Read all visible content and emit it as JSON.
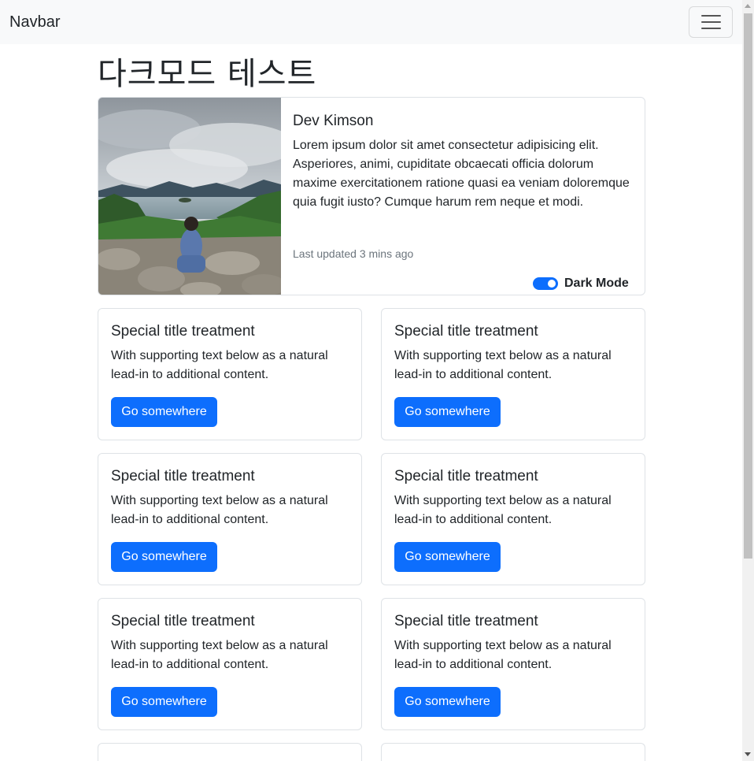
{
  "navbar": {
    "brand": "Navbar",
    "toggler_icon": "hamburger-icon"
  },
  "page": {
    "title": "다크모드 테스트"
  },
  "profile": {
    "name": "Dev Kimson",
    "text": "Lorem ipsum dolor sit amet consectetur adipisicing elit. Asperiores, animi, cupiditate obcaecati officia dolorum maxime exercitationem ratione quasi ea veniam doloremque quia fugit iusto? Cumque harum rem neque et modi.",
    "updated": "Last updated 3 mins ago",
    "dark_mode_label": "Dark Mode",
    "dark_mode_on": true
  },
  "cards": [
    {
      "title": "Special title treatment",
      "text": "With supporting text below as a natural lead-in to additional content.",
      "button": "Go somewhere"
    },
    {
      "title": "Special title treatment",
      "text": "With supporting text below as a natural lead-in to additional content.",
      "button": "Go somewhere"
    },
    {
      "title": "Special title treatment",
      "text": "With supporting text below as a natural lead-in to additional content.",
      "button": "Go somewhere"
    },
    {
      "title": "Special title treatment",
      "text": "With supporting text below as a natural lead-in to additional content.",
      "button": "Go somewhere"
    },
    {
      "title": "Special title treatment",
      "text": "With supporting text below as a natural lead-in to additional content.",
      "button": "Go somewhere"
    },
    {
      "title": "Special title treatment",
      "text": "With supporting text below as a natural lead-in to additional content.",
      "button": "Go somewhere"
    }
  ],
  "colors": {
    "primary": "#0d6efd",
    "navbar_bg": "#f8f9fa",
    "border": "#dee2e6",
    "muted": "#6c757d"
  }
}
